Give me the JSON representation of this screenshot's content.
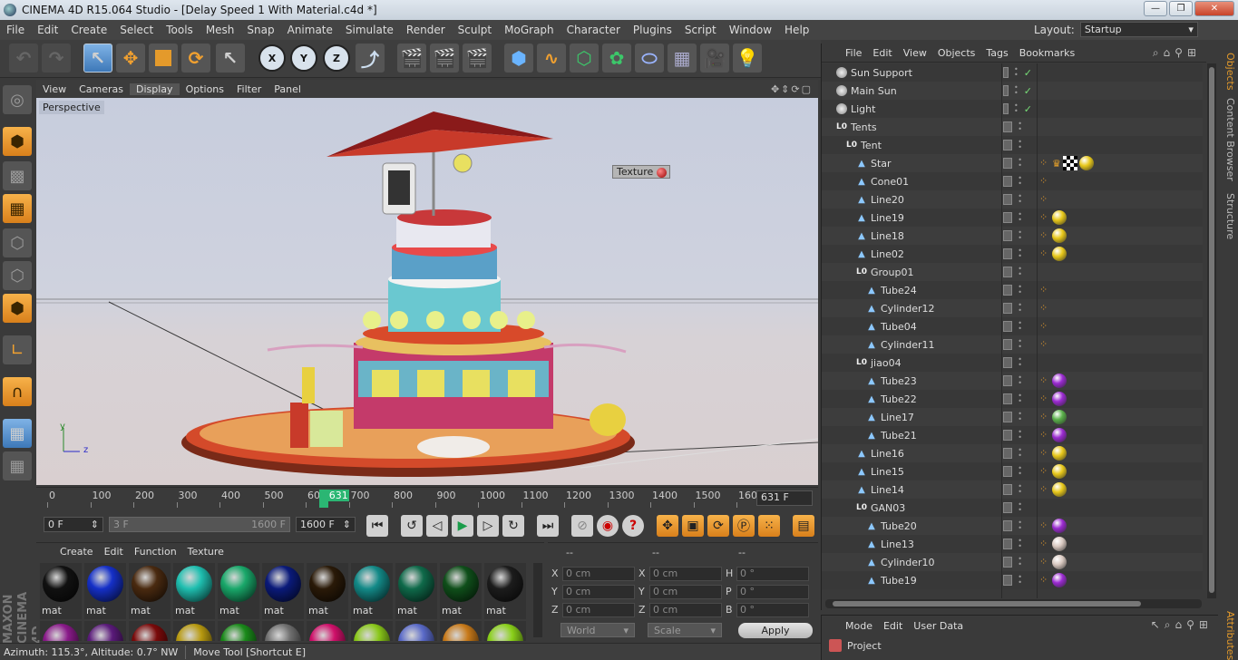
{
  "window": {
    "title": "CINEMA 4D R15.064 Studio - [Delay Speed 1 With Material.c4d *]",
    "minimize": "—",
    "maximize": "❐",
    "close": "✕"
  },
  "menubar": [
    "File",
    "Edit",
    "Create",
    "Select",
    "Tools",
    "Mesh",
    "Snap",
    "Animate",
    "Simulate",
    "Render",
    "Sculpt",
    "MoGraph",
    "Character",
    "Plugins",
    "Script",
    "Window",
    "Help"
  ],
  "layout": {
    "label": "Layout:",
    "value": "Startup"
  },
  "axis_buttons": {
    "x": "X",
    "y": "Y",
    "z": "Z"
  },
  "viewport": {
    "menu": [
      "View",
      "Cameras",
      "Display",
      "Options",
      "Filter",
      "Panel"
    ],
    "active_menu": "Display",
    "nav_icons": "✥⇕⟳▢",
    "label": "Perspective",
    "texture_tag": "Texture",
    "axis_y": "y",
    "axis_z": "z"
  },
  "timeline": {
    "ticks": [
      "0",
      "100",
      "200",
      "300",
      "400",
      "500",
      "600",
      "700",
      "800",
      "900",
      "1000",
      "1100",
      "1200",
      "1300",
      "1400",
      "1500",
      "1600"
    ],
    "current_frame_label": "631",
    "current_frame": 631,
    "max_frame": 1600,
    "frame_field": "631 F"
  },
  "transport": {
    "start_field": "0 F",
    "range_start": "3 F",
    "range_end": "1600 F",
    "end_field": "1600 F"
  },
  "materials": {
    "menu": [
      "Create",
      "Edit",
      "Function",
      "Texture"
    ],
    "items": [
      {
        "label": "mat",
        "color": "#111111"
      },
      {
        "label": "mat",
        "color": "#1530c8"
      },
      {
        "label": "mat",
        "color": "#4a2a10"
      },
      {
        "label": "mat",
        "color": "#1fbfb0"
      },
      {
        "label": "mat",
        "color": "#19a86a"
      },
      {
        "label": "mat",
        "color": "#0a1a7a"
      },
      {
        "label": "mat",
        "color": "#2a1a08"
      },
      {
        "label": "mat",
        "color": "#138a88"
      },
      {
        "label": "mat",
        "color": "#0f6a4a"
      },
      {
        "label": "mat",
        "color": "#0f4f1a"
      },
      {
        "label": "mat",
        "color": "#1c1c1c"
      }
    ],
    "row2_colors": [
      "#8a1a8a",
      "#5a1a7a",
      "#7a0a0a",
      "#b89a10",
      "#1a8a1a",
      "#707070",
      "#d0106a",
      "#8ac81a",
      "#5a6ac8",
      "#c87a1a",
      "#8ad01a"
    ]
  },
  "coordinates": {
    "headers": [
      "--",
      "--",
      "--"
    ],
    "rows": [
      {
        "l1": "X",
        "v1": "0 cm",
        "l2": "X",
        "v2": "0 cm",
        "l3": "H",
        "v3": "0 °"
      },
      {
        "l1": "Y",
        "v1": "0 cm",
        "l2": "Y",
        "v2": "0 cm",
        "l3": "P",
        "v3": "0 °"
      },
      {
        "l1": "Z",
        "v1": "0 cm",
        "l2": "Z",
        "v2": "0 cm",
        "l3": "B",
        "v3": "0 °"
      }
    ],
    "world": "World",
    "scale": "Scale",
    "apply": "Apply"
  },
  "status": {
    "azimuth": "Azimuth: 115.3°, Altitude: 0.7°  NW",
    "tool": "Move Tool [Shortcut E]"
  },
  "objects": {
    "menu": [
      "File",
      "Edit",
      "View",
      "Objects",
      "Tags",
      "Bookmarks"
    ],
    "icons": "⌕⌂⚲⊞",
    "rows": [
      {
        "name": "Sun Support",
        "indent": 0,
        "icon": "light",
        "check": "✓",
        "tags": []
      },
      {
        "name": "Main Sun",
        "indent": 0,
        "icon": "light",
        "check": "✓",
        "tags": []
      },
      {
        "name": "Light",
        "indent": 0,
        "icon": "light",
        "check": "✓",
        "tags": []
      },
      {
        "name": "Tents",
        "indent": 0,
        "icon": "null",
        "check": "",
        "tags": []
      },
      {
        "name": "Tent",
        "indent": 1,
        "icon": "null",
        "check": "",
        "tags": []
      },
      {
        "name": "Star",
        "indent": 2,
        "icon": "obj",
        "check": "",
        "tags": [
          "dot",
          "crown",
          "checker",
          "#e8c81a"
        ]
      },
      {
        "name": "Cone01",
        "indent": 2,
        "icon": "obj",
        "check": "",
        "tags": [
          "dot"
        ]
      },
      {
        "name": "Line20",
        "indent": 2,
        "icon": "obj",
        "check": "",
        "tags": [
          "dot"
        ]
      },
      {
        "name": "Line19",
        "indent": 2,
        "icon": "obj",
        "check": "",
        "tags": [
          "dot",
          "#e8c81a"
        ]
      },
      {
        "name": "Line18",
        "indent": 2,
        "icon": "obj",
        "check": "",
        "tags": [
          "dot",
          "#e8c81a"
        ]
      },
      {
        "name": "Line02",
        "indent": 2,
        "icon": "obj",
        "check": "",
        "tags": [
          "dot",
          "#e8c81a"
        ]
      },
      {
        "name": "Group01",
        "indent": 2,
        "icon": "null",
        "check": "",
        "tags": []
      },
      {
        "name": "Tube24",
        "indent": 3,
        "icon": "obj",
        "check": "",
        "tags": [
          "dot"
        ]
      },
      {
        "name": "Cylinder12",
        "indent": 3,
        "icon": "obj",
        "check": "",
        "tags": [
          "dot"
        ]
      },
      {
        "name": "Tube04",
        "indent": 3,
        "icon": "obj",
        "check": "",
        "tags": [
          "dot"
        ]
      },
      {
        "name": "Cylinder11",
        "indent": 3,
        "icon": "obj",
        "check": "",
        "tags": [
          "dot"
        ]
      },
      {
        "name": "jiao04",
        "indent": 2,
        "icon": "null",
        "check": "",
        "tags": []
      },
      {
        "name": "Tube23",
        "indent": 3,
        "icon": "obj",
        "check": "",
        "tags": [
          "dot",
          "#9a2ad0"
        ]
      },
      {
        "name": "Tube22",
        "indent": 3,
        "icon": "obj",
        "check": "",
        "tags": [
          "dot",
          "#9a2ad0"
        ]
      },
      {
        "name": "Line17",
        "indent": 3,
        "icon": "obj",
        "check": "",
        "tags": [
          "dot",
          "#5ab04a"
        ]
      },
      {
        "name": "Tube21",
        "indent": 3,
        "icon": "obj",
        "check": "",
        "tags": [
          "dot",
          "#9a2ad0"
        ]
      },
      {
        "name": "Line16",
        "indent": 2,
        "icon": "obj",
        "check": "",
        "tags": [
          "dot",
          "#e8c81a"
        ]
      },
      {
        "name": "Line15",
        "indent": 2,
        "icon": "obj",
        "check": "",
        "tags": [
          "dot",
          "#e8c81a"
        ]
      },
      {
        "name": "Line14",
        "indent": 2,
        "icon": "obj",
        "check": "",
        "tags": [
          "dot",
          "#e8c81a"
        ]
      },
      {
        "name": "GAN03",
        "indent": 2,
        "icon": "null",
        "check": "",
        "tags": []
      },
      {
        "name": "Tube20",
        "indent": 3,
        "icon": "obj",
        "check": "",
        "tags": [
          "dot",
          "#9a2ad0"
        ]
      },
      {
        "name": "Line13",
        "indent": 3,
        "icon": "obj",
        "check": "",
        "tags": [
          "dot",
          "#d8c8c0"
        ]
      },
      {
        "name": "Cylinder10",
        "indent": 3,
        "icon": "obj",
        "check": "",
        "tags": [
          "dot",
          "#d8c8c0"
        ]
      },
      {
        "name": "Tube19",
        "indent": 3,
        "icon": "obj",
        "check": "",
        "tags": [
          "dot",
          "#9a2ad0"
        ]
      }
    ]
  },
  "side_tabs": [
    "Objects",
    "Content Browser",
    "Structure"
  ],
  "attributes": {
    "menu": [
      "Mode",
      "Edit",
      "User Data"
    ],
    "icons": "↖⌕⌂⚲⊞",
    "row_label": "Project",
    "side_tab": "Attributes"
  },
  "colors": {
    "accent_orange": "#e49a2b",
    "playhead_green": "#2bb673",
    "tool_blue": "#3d78b8"
  }
}
